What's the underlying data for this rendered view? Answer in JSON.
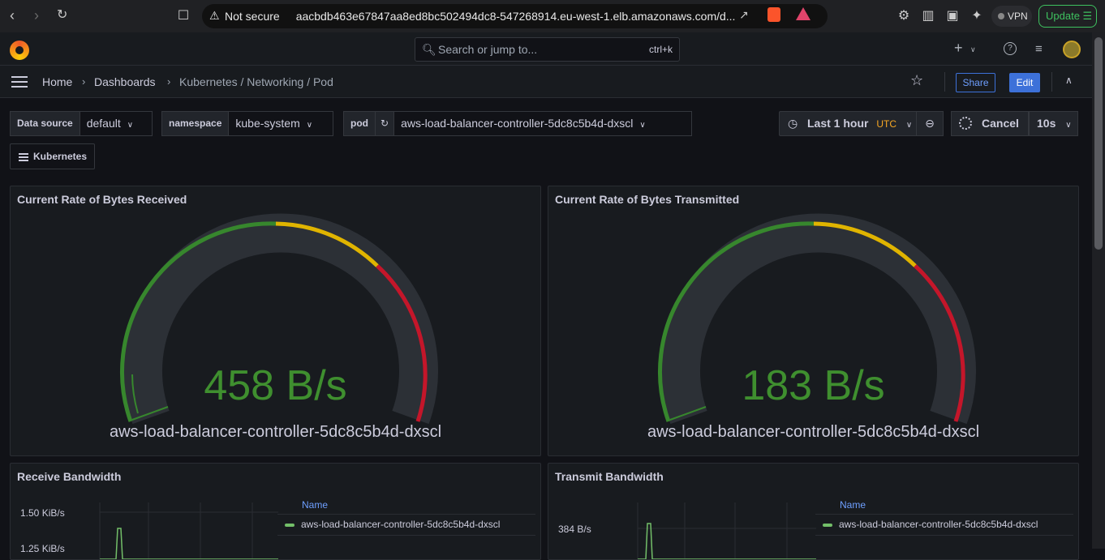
{
  "browser": {
    "security_label": "Not secure",
    "url": "aacbdb463e67847aa8ed8bc502494dc8-547268914.eu-west-1.elb.amazonaws.com/d...",
    "vpn_label": "VPN",
    "update_label": "Update"
  },
  "topbar": {
    "search_placeholder": "Search or jump to...",
    "search_shortcut": "ctrl+k"
  },
  "breadcrumb": {
    "home": "Home",
    "dashboards": "Dashboards",
    "current": "Kubernetes / Networking / Pod",
    "share_label": "Share",
    "edit_label": "Edit"
  },
  "variables": {
    "datasource_label": "Data source",
    "datasource_value": "default",
    "namespace_label": "namespace",
    "namespace_value": "kube-system",
    "pod_label": "pod",
    "pod_value": "aws-load-balancer-controller-5dc8c5b4d-dxscl"
  },
  "time": {
    "range_label": "Last 1 hour",
    "timezone": "UTC",
    "cancel_label": "Cancel",
    "refresh_interval": "10s"
  },
  "links": {
    "kubernetes_label": "Kubernetes"
  },
  "panels": {
    "bytes_received": {
      "title": "Current Rate of Bytes Received",
      "value": "458 B/s",
      "name": "aws-load-balancer-controller-5dc8c5b4d-dxscl"
    },
    "bytes_transmitted": {
      "title": "Current Rate of Bytes Transmitted",
      "value": "183 B/s",
      "name": "aws-load-balancer-controller-5dc8c5b4d-dxscl"
    },
    "receive_bandwidth": {
      "title": "Receive Bandwidth",
      "ytick_1": "1.50 KiB/s",
      "ytick_2": "1.25 KiB/s",
      "legend_header": "Name",
      "legend_item": "aws-load-balancer-controller-5dc8c5b4d-dxscl"
    },
    "transmit_bandwidth": {
      "title": "Transmit Bandwidth",
      "ytick_1": "384 B/s",
      "legend_header": "Name",
      "legend_item": "aws-load-balancer-controller-5dc8c5b4d-dxscl"
    }
  },
  "colors": {
    "gauge_green": "#37872d",
    "gauge_yellow": "#e0b400",
    "gauge_red": "#c4162a",
    "value_green": "#3f8f2f",
    "accent_blue": "#3d71d9",
    "series_green": "#73bf69"
  }
}
